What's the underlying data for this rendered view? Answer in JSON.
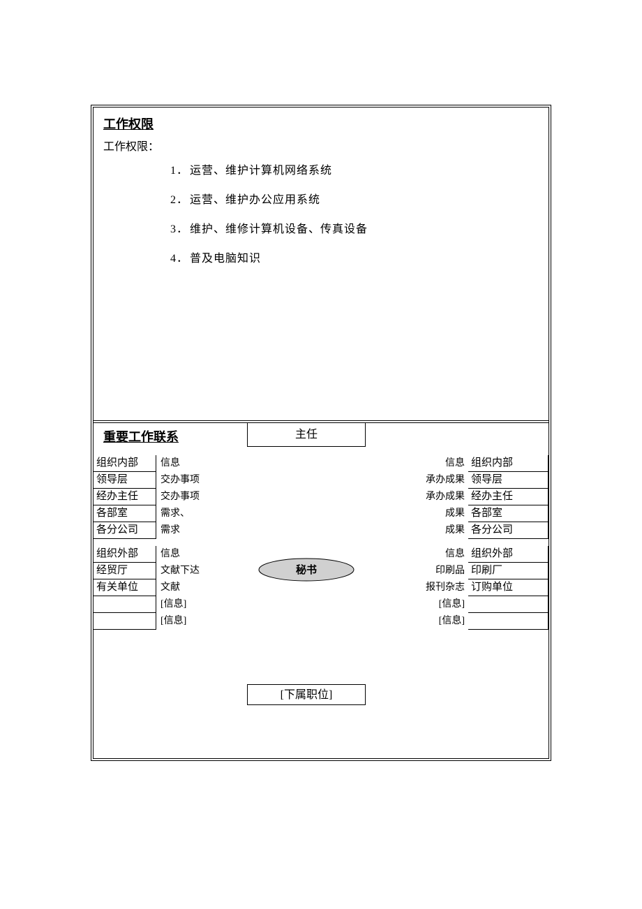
{
  "section1": {
    "title": "工作权限",
    "label": "工作权限：",
    "items": [
      {
        "n": "1．",
        "t": "运营、维护计算机网络系统"
      },
      {
        "n": "2．",
        "t": "运营、维护办公应用系统"
      },
      {
        "n": "3．",
        "t": "维护、维修计算机设备、传真设备"
      },
      {
        "n": "4．",
        "t": "普及电脑知识"
      }
    ]
  },
  "section2": {
    "title": "重要工作联系",
    "top_box": "主任",
    "bottom_box": "[下属职位]",
    "center": "秘书",
    "left_group1": [
      "组织内部",
      "领导层",
      "经办主任",
      "各部室",
      "各分公司"
    ],
    "left_group2": [
      "组织外部",
      "经贸厅",
      "有关单位",
      "",
      ""
    ],
    "left_info1": [
      "信息",
      "交办事项",
      "交办事项",
      "需求、",
      "需求"
    ],
    "left_info2": [
      "信息",
      "文献下达",
      "文献",
      "[信息]",
      "[信息]"
    ],
    "right_group1": [
      "组织内部",
      "领导层",
      "经办主任",
      "各部室",
      "各分公司"
    ],
    "right_group2": [
      "组织外部",
      "印刷厂",
      "订购单位",
      "",
      ""
    ],
    "right_info1": [
      "信息",
      "承办成果",
      "承办成果",
      "成果",
      "成果"
    ],
    "right_info2": [
      "信息",
      "印刷品",
      "报刊杂志",
      "[信息]",
      "[信息]"
    ]
  }
}
